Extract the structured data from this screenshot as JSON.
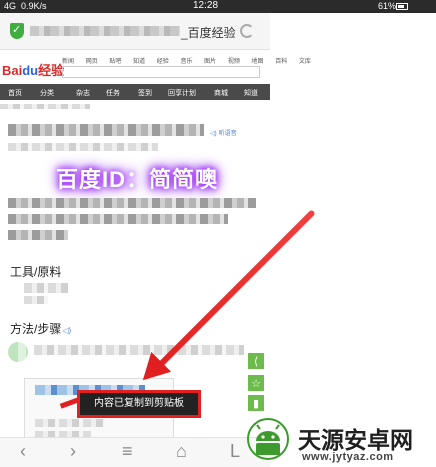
{
  "status_bar": {
    "network": "4G",
    "speed": "0.9K/s",
    "time": "12:28",
    "battery": "61%"
  },
  "address_bar": {
    "title_suffix": "_百度经验"
  },
  "logo": {
    "bai": "Bai",
    "paw": "du",
    "jingyan": "经验"
  },
  "top_nav": [
    "新闻",
    "网页",
    "贴吧",
    "知道",
    "经验",
    "音乐",
    "图片",
    "视频",
    "地图",
    "百科",
    "文库"
  ],
  "category_bar": [
    "首页",
    "分类",
    "杂志",
    "任务",
    "签到",
    "回享计划",
    "商城",
    "知道"
  ],
  "article": {
    "audio_label": "听语音",
    "watermark": "百度ID：简简噢",
    "tools_heading": "工具/原料",
    "steps_heading": "方法/步骤"
  },
  "toast": {
    "text": "内容已复制到剪贴板"
  },
  "side_buttons": [
    "分享",
    "收藏",
    "书签"
  ],
  "bottom_nav": [
    "back",
    "forward",
    "menu",
    "home",
    "tabs"
  ],
  "brand": {
    "name": "天源安卓网",
    "url": "www.jytyaz.com"
  },
  "colors": {
    "status_bar": "#2b2b2b",
    "category_bar": "#4a4a4a",
    "shield": "#3fae3f",
    "side_button": "#6dbb4a",
    "annotation_red": "#e02020",
    "watermark_glow": "#a02cff"
  }
}
